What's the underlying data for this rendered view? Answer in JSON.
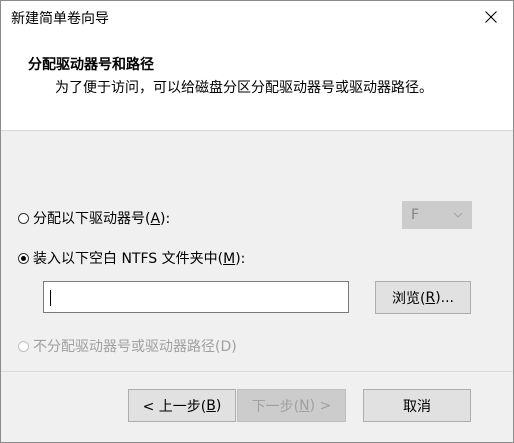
{
  "window": {
    "title": "新建简单卷向导"
  },
  "header": {
    "heading": "分配驱动器号和路径",
    "subheading": "为了便于访问，可以给磁盘分区分配驱动器号或驱动器路径。"
  },
  "options": {
    "assign_letter": {
      "pre": "分配以下驱动器号(",
      "key": "A",
      "post": "):",
      "checked": false,
      "enabled": true
    },
    "mount_folder": {
      "pre": "装入以下空白 NTFS 文件夹中(",
      "key": "M",
      "post": "):",
      "checked": true,
      "enabled": true
    },
    "no_assign": {
      "label": "不分配驱动器号或驱动器路径(D)",
      "checked": false,
      "enabled": false
    }
  },
  "drive_select": {
    "value": "F",
    "enabled": false
  },
  "path_input": {
    "value": ""
  },
  "buttons": {
    "browse": {
      "pre": "浏览(",
      "key": "R",
      "post": ")..."
    },
    "back": {
      "pre": "< 上一步(",
      "key": "B",
      "post": ")"
    },
    "next": {
      "pre": "下一步(",
      "key": "N",
      "post": ") >"
    },
    "cancel": {
      "label": "取消"
    }
  },
  "colors": {
    "accent": "#0078d7",
    "disabled_text": "#a0a0a0"
  }
}
